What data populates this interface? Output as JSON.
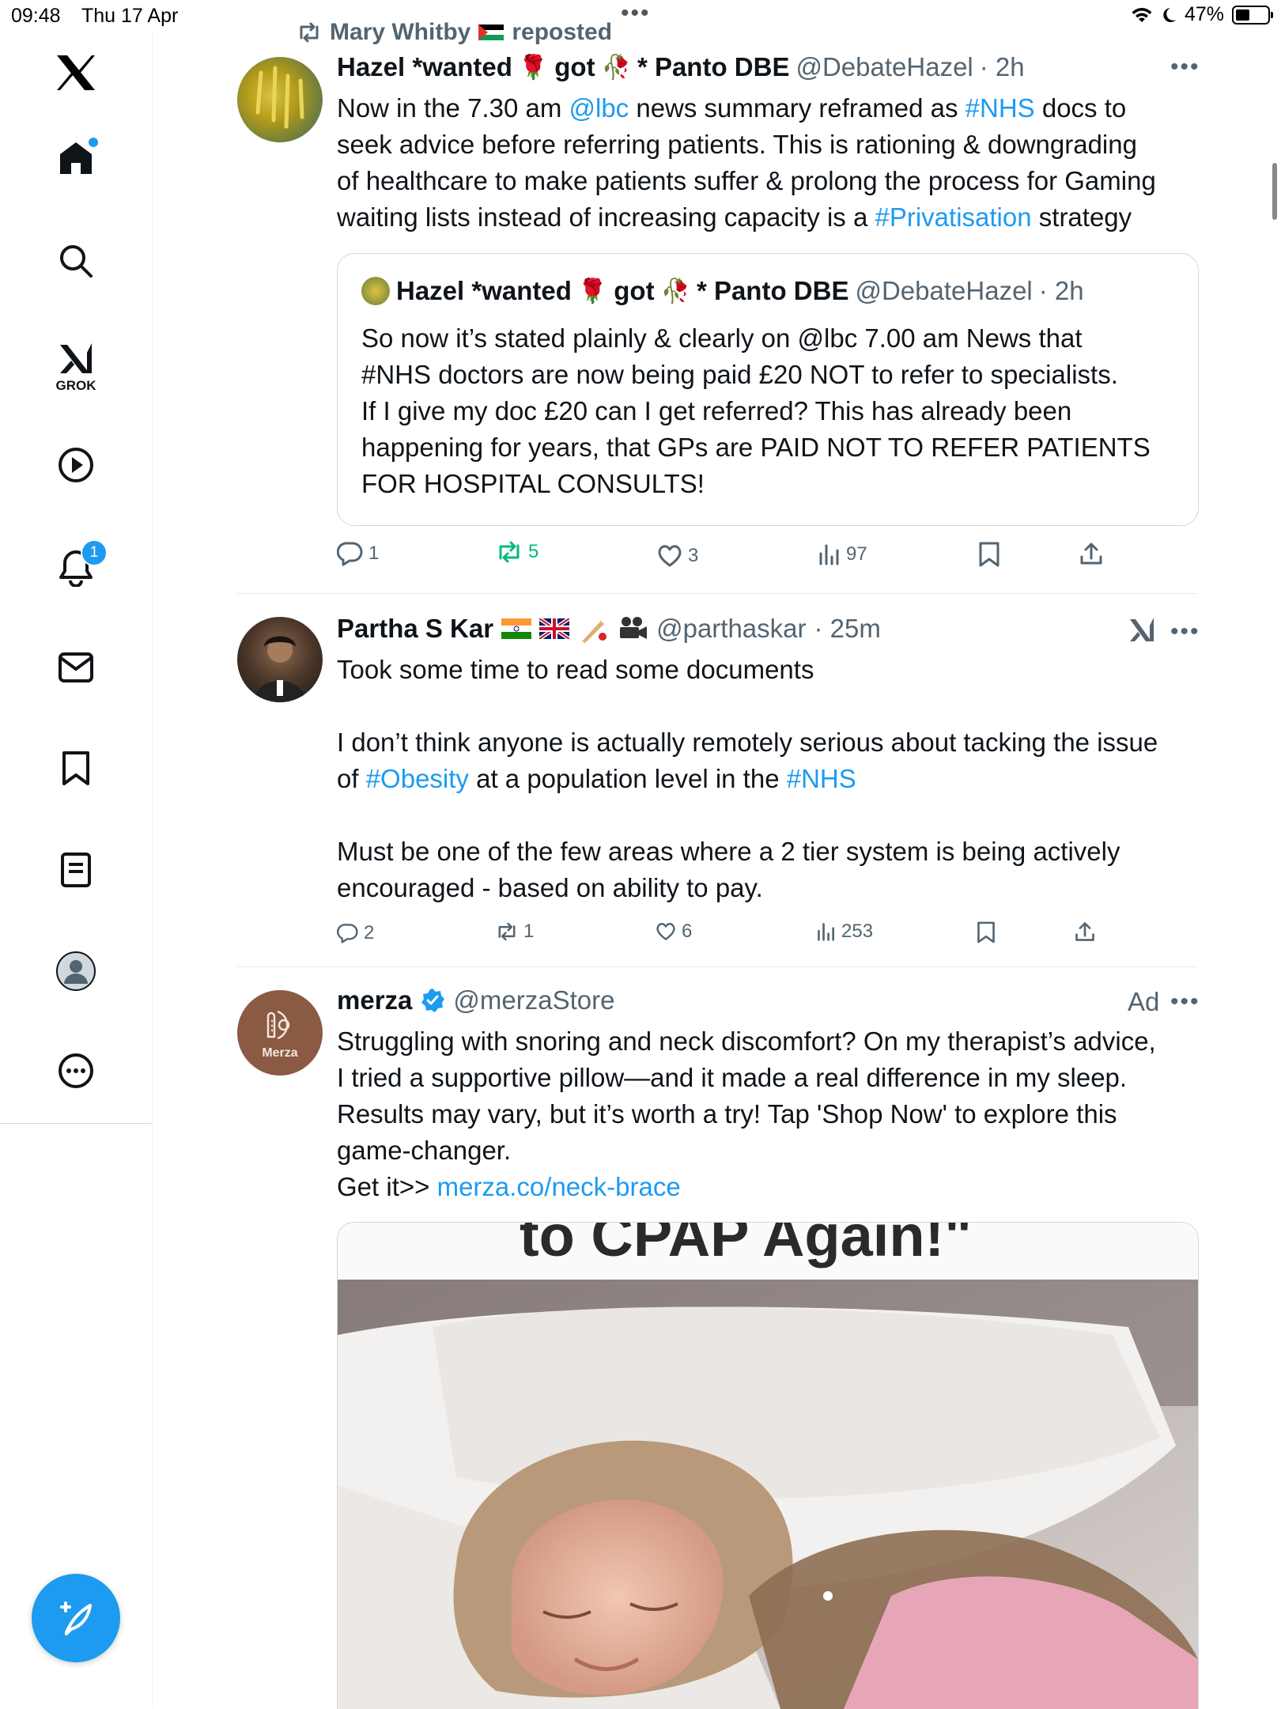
{
  "status_bar": {
    "time": "09:48",
    "date": "Thu 17 Apr",
    "battery": "47%",
    "battery_level": 0.47
  },
  "sidebar": {
    "grok_label": "GROK",
    "notifications_badge": "1",
    "icons": [
      "x-logo-icon",
      "home-icon",
      "search-icon",
      "grok-icon",
      "video-icon",
      "notifications-icon",
      "messages-icon",
      "bookmarks-icon",
      "lists-icon",
      "profile-icon",
      "more-icon"
    ]
  },
  "repost_banner": {
    "user": "Mary Whitby",
    "label": "reposted"
  },
  "tweets": [
    {
      "name": "Hazel *wanted",
      "name_part2": "got",
      "name_part3": "* Panto DBE",
      "handle": "@DebateHazel",
      "time": "· 2h",
      "text_lines": [
        [
          "Now in the 7.30 am ",
          "@lbc",
          " news summary reframed as ",
          "#NHS",
          " docs to"
        ],
        [
          "seek advice before referring patients.  This is rationing & downgrading"
        ],
        [
          "of healthcare to make patients suffer  & prolong the process for Gaming"
        ],
        [
          "waiting lists instead of increasing capacity is a ",
          "#Privatisation",
          " strategy"
        ]
      ],
      "quote": {
        "name": "Hazel *wanted",
        "name_part2": "got",
        "name_part3": "* Panto DBE",
        "handle": "@DebateHazel",
        "time": "· 2h",
        "lines": [
          "So now it’s stated plainly & clearly on @lbc 7.00 am News that",
          "#NHS doctors are now being paid £20 NOT to refer to specialists.",
          "If I give my doc £20 can I get referred? This has already been",
          "happening for years, that GPs are PAID NOT TO REFER PATIENTS",
          "FOR HOSPITAL CONSULTS!"
        ]
      },
      "replies": "1",
      "reposts": "5",
      "likes": "3",
      "views": "97"
    },
    {
      "name": "Partha S Kar",
      "handle": "@parthaskar",
      "time": "· 25m",
      "p1": "Took some time to read some documents",
      "p2_line1": "I don’t think anyone is actually remotely serious about tacking the issue",
      "p2_line2_a": "of ",
      "p2_line2_b": "#Obesity",
      "p2_line2_c": " at a population level in the ",
      "p2_line2_d": "#NHS",
      "p3_line1": "Must be one of the few areas where a 2 tier system is being actively",
      "p3_line2": "encouraged - based on ability to pay.",
      "replies": "2",
      "reposts": "1",
      "likes": "6",
      "views": "253"
    },
    {
      "name": "merza",
      "handle": "@merzaStore",
      "ad_label": "Ad",
      "avatar_text": "Merza",
      "lines": [
        "Struggling with snoring and neck discomfort? On my therapist’s advice,",
        "I tried a supportive pillow—and it made a real difference in my sleep.",
        "Results may vary, but it’s worth a try! Tap 'Shop Now' to explore this",
        "game-changer."
      ],
      "link_prefix": "Get it>> ",
      "link": "merza.co/neck-brace",
      "media_caption": "to CPAP Again!\""
    }
  ],
  "colors": {
    "accent": "#1d9bf0",
    "repost_green": "#00ba7c",
    "muted": "#536471"
  }
}
